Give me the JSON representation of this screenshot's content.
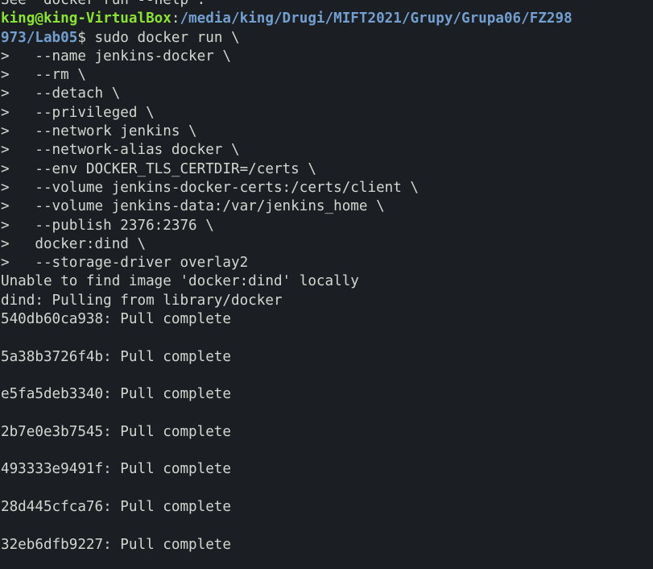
{
  "colors": {
    "background": "#1b1f24",
    "text": "#d3d7cf",
    "prompt_user": "#8ae234",
    "prompt_path": "#729fcf"
  },
  "top_partial": "See 'docker run --help'.",
  "prompt": {
    "user_host": "king@king-VirtualBox",
    "sep": ":",
    "path_line1": "/media/king/Drugi/MIFT2021/Grupy/Grupa06/FZ298",
    "path_line2": "973/Lab05",
    "dollar": "$ ",
    "command": "sudo docker run \\"
  },
  "continuation_lines": [
    ">   --name jenkins-docker \\",
    ">   --rm \\",
    ">   --detach \\",
    ">   --privileged \\",
    ">   --network jenkins \\",
    ">   --network-alias docker \\",
    ">   --env DOCKER_TLS_CERTDIR=/certs \\",
    ">   --volume jenkins-docker-certs:/certs/client \\",
    ">   --volume jenkins-data:/var/jenkins_home \\",
    ">   --publish 2376:2376 \\",
    ">   docker:dind \\",
    ">   --storage-driver overlay2"
  ],
  "output": {
    "unable": "Unable to find image 'docker:dind' locally",
    "pulling": "dind: Pulling from library/docker",
    "pulls": [
      "540db60ca938: Pull complete",
      "5a38b3726f4b: Pull complete",
      "e5fa5deb3340: Pull complete",
      "2b7e0e3b7545: Pull complete",
      "493333e9491f: Pull complete",
      "28d445cfca76: Pull complete",
      "32eb6dfb9227: Pull complete"
    ]
  }
}
